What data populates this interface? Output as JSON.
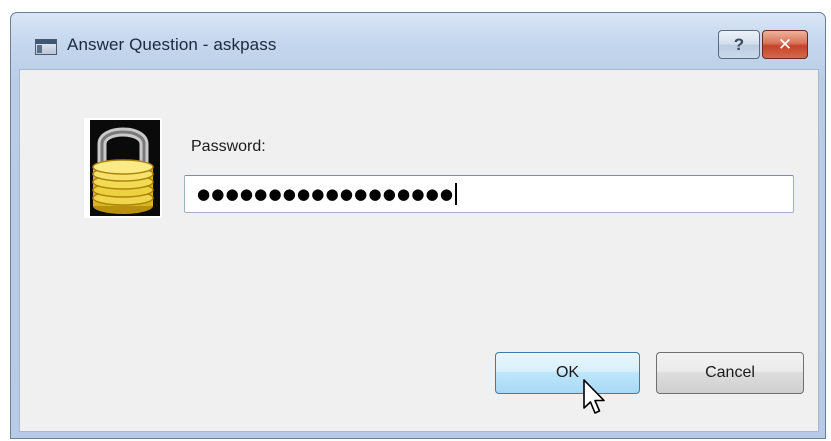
{
  "window": {
    "title": "Answer Question - askpass",
    "icon": "window-app-icon",
    "help_label": "?",
    "close_label": "✕"
  },
  "dialog": {
    "icon": "padlock-icon",
    "password_label": "Password:",
    "password_value": "●●●●●●●●●●●●●●●●●●",
    "password_length": 18
  },
  "buttons": {
    "ok_label": "OK",
    "cancel_label": "Cancel"
  },
  "colors": {
    "accent": "#3d7bad",
    "close": "#c5432a",
    "lock_gold": "#e3c22a"
  }
}
